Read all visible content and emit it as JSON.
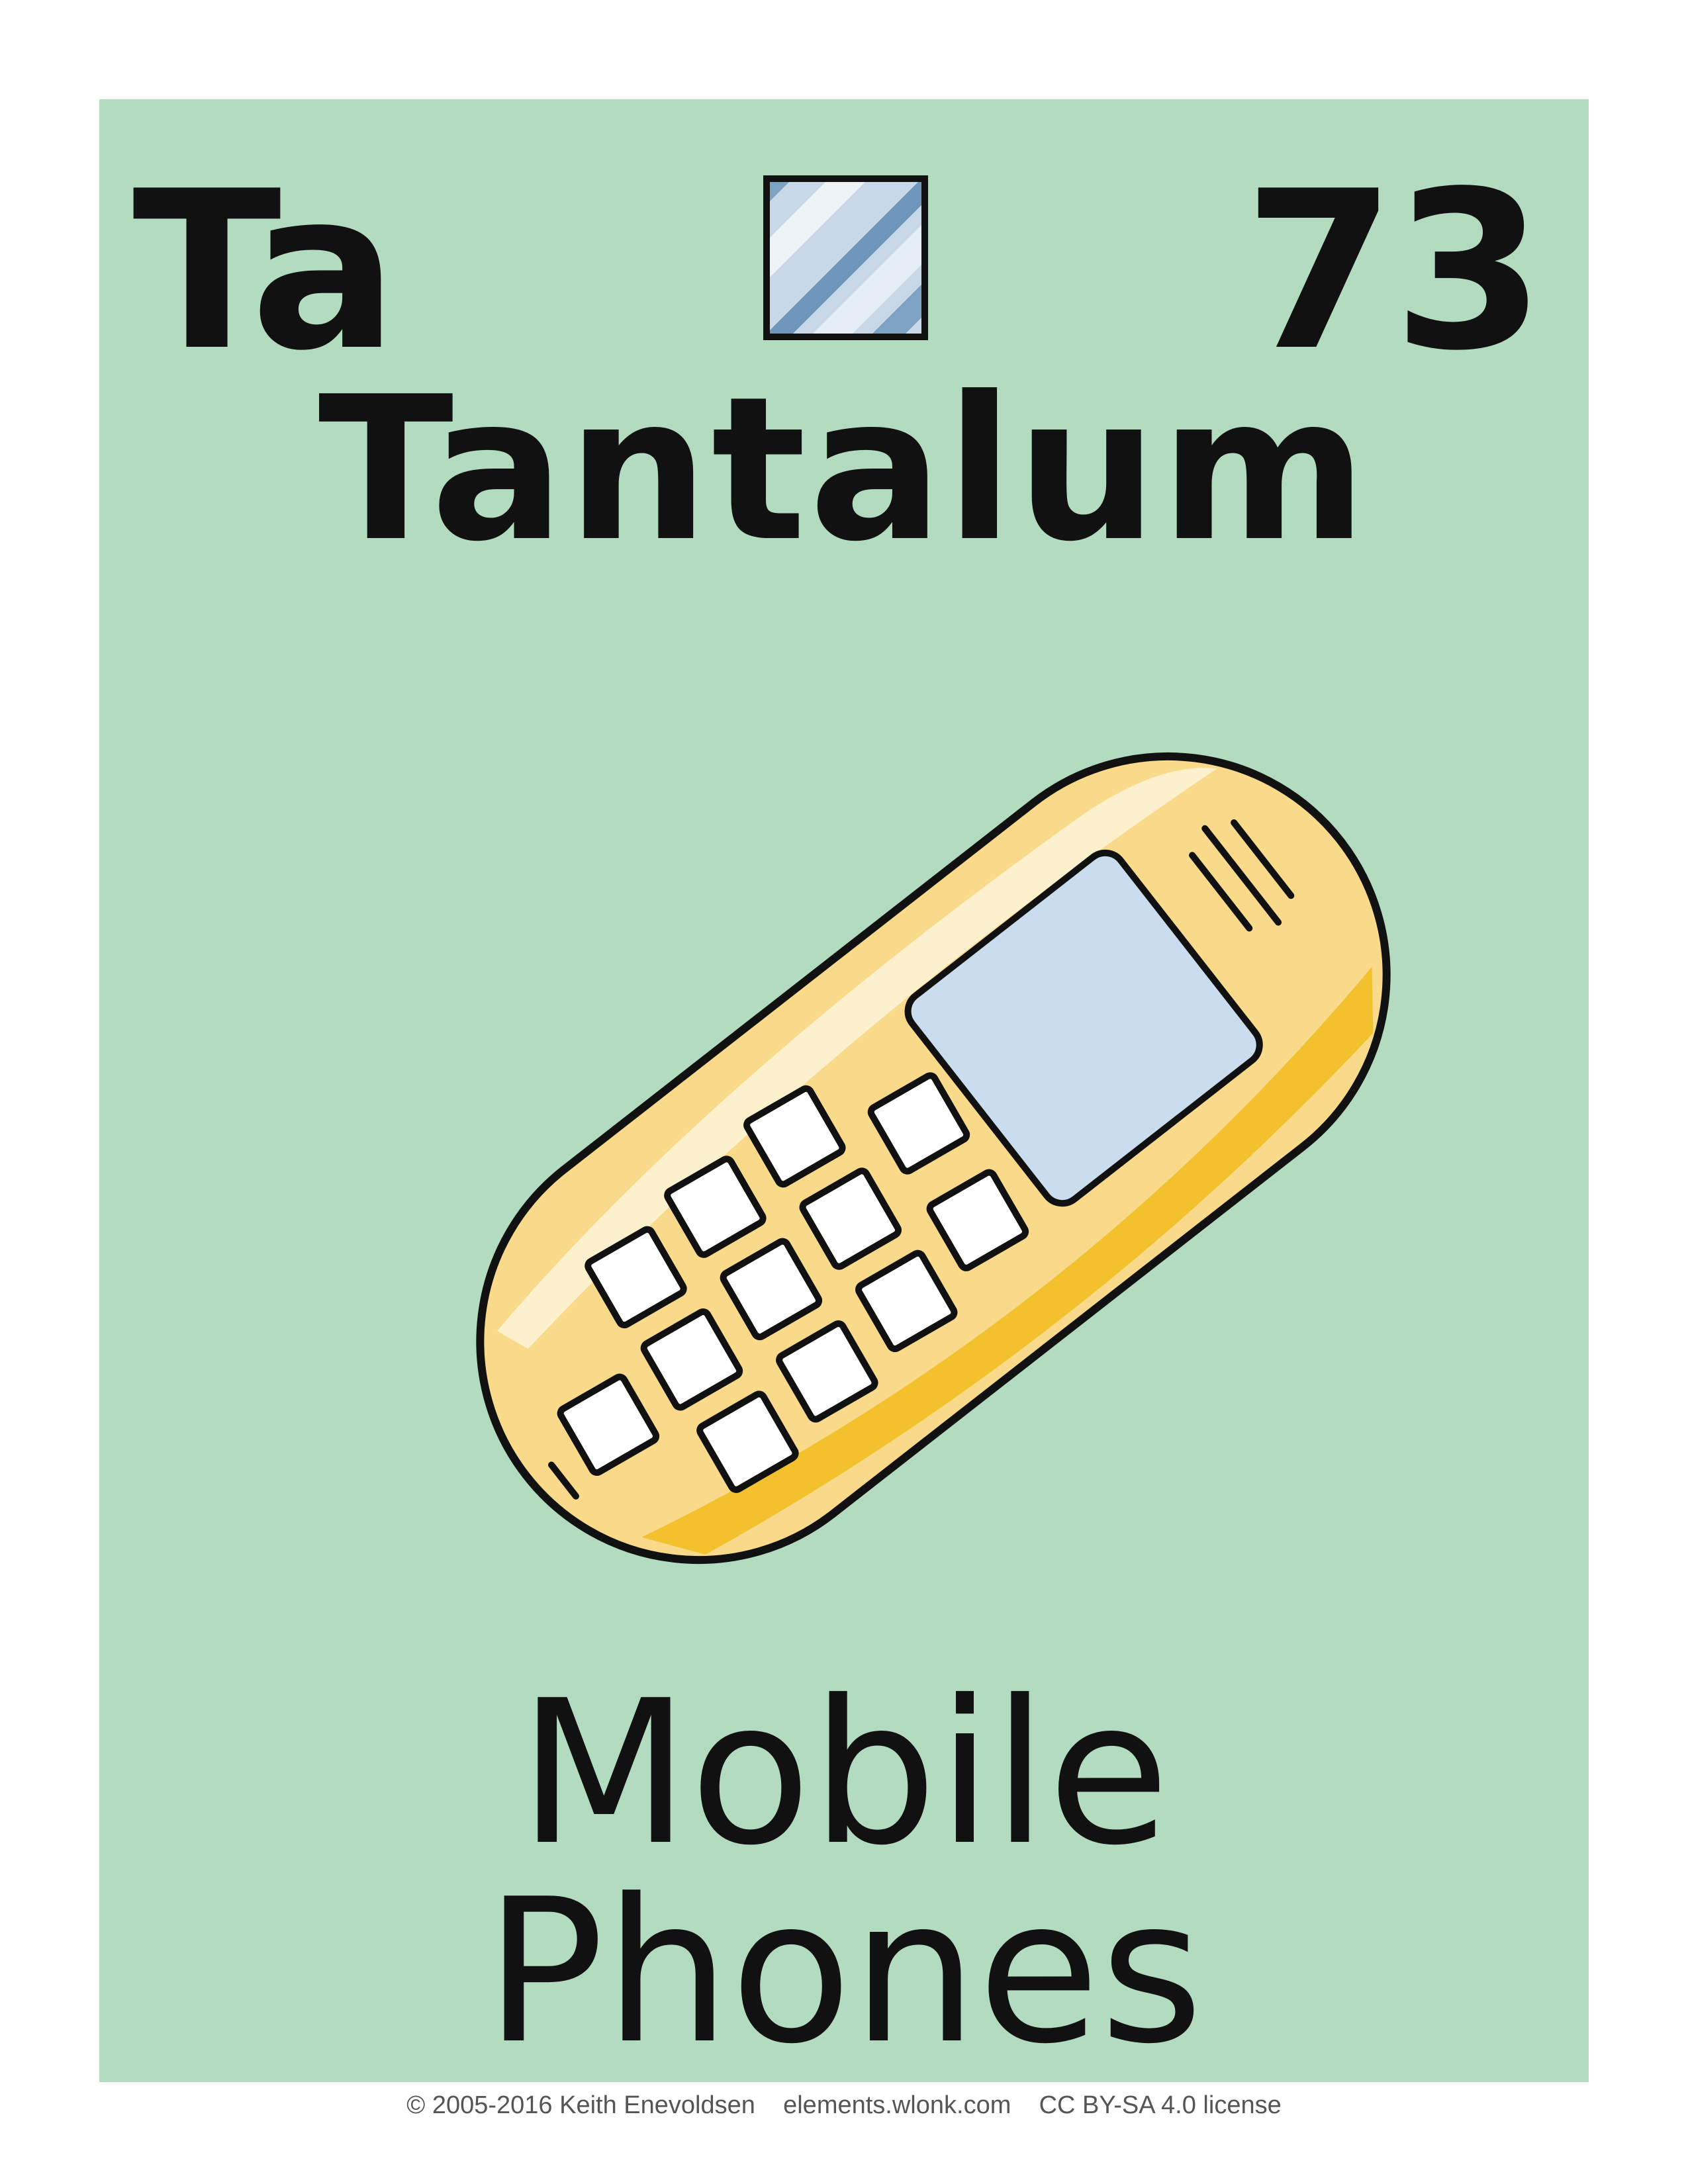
{
  "element": {
    "symbol": "Ta",
    "atomic_number": "73",
    "name": "Tantalum"
  },
  "use": {
    "line1": "Mobile",
    "line2": "Phones"
  },
  "illustration": {
    "icon": "mobile-phone-icon",
    "swatch_icon": "metal-swatch-icon"
  },
  "footer": {
    "copyright": "© 2005-2016 Keith Enevoldsen",
    "site": "elements.wlonk.com",
    "license": "CC BY-SA 4.0 license"
  },
  "colors": {
    "card_background": "#b2dbbf",
    "phone_body": "#f9d98a",
    "phone_shadow": "#f3c12e",
    "screen": "#c9ddee",
    "outline": "#111111"
  }
}
